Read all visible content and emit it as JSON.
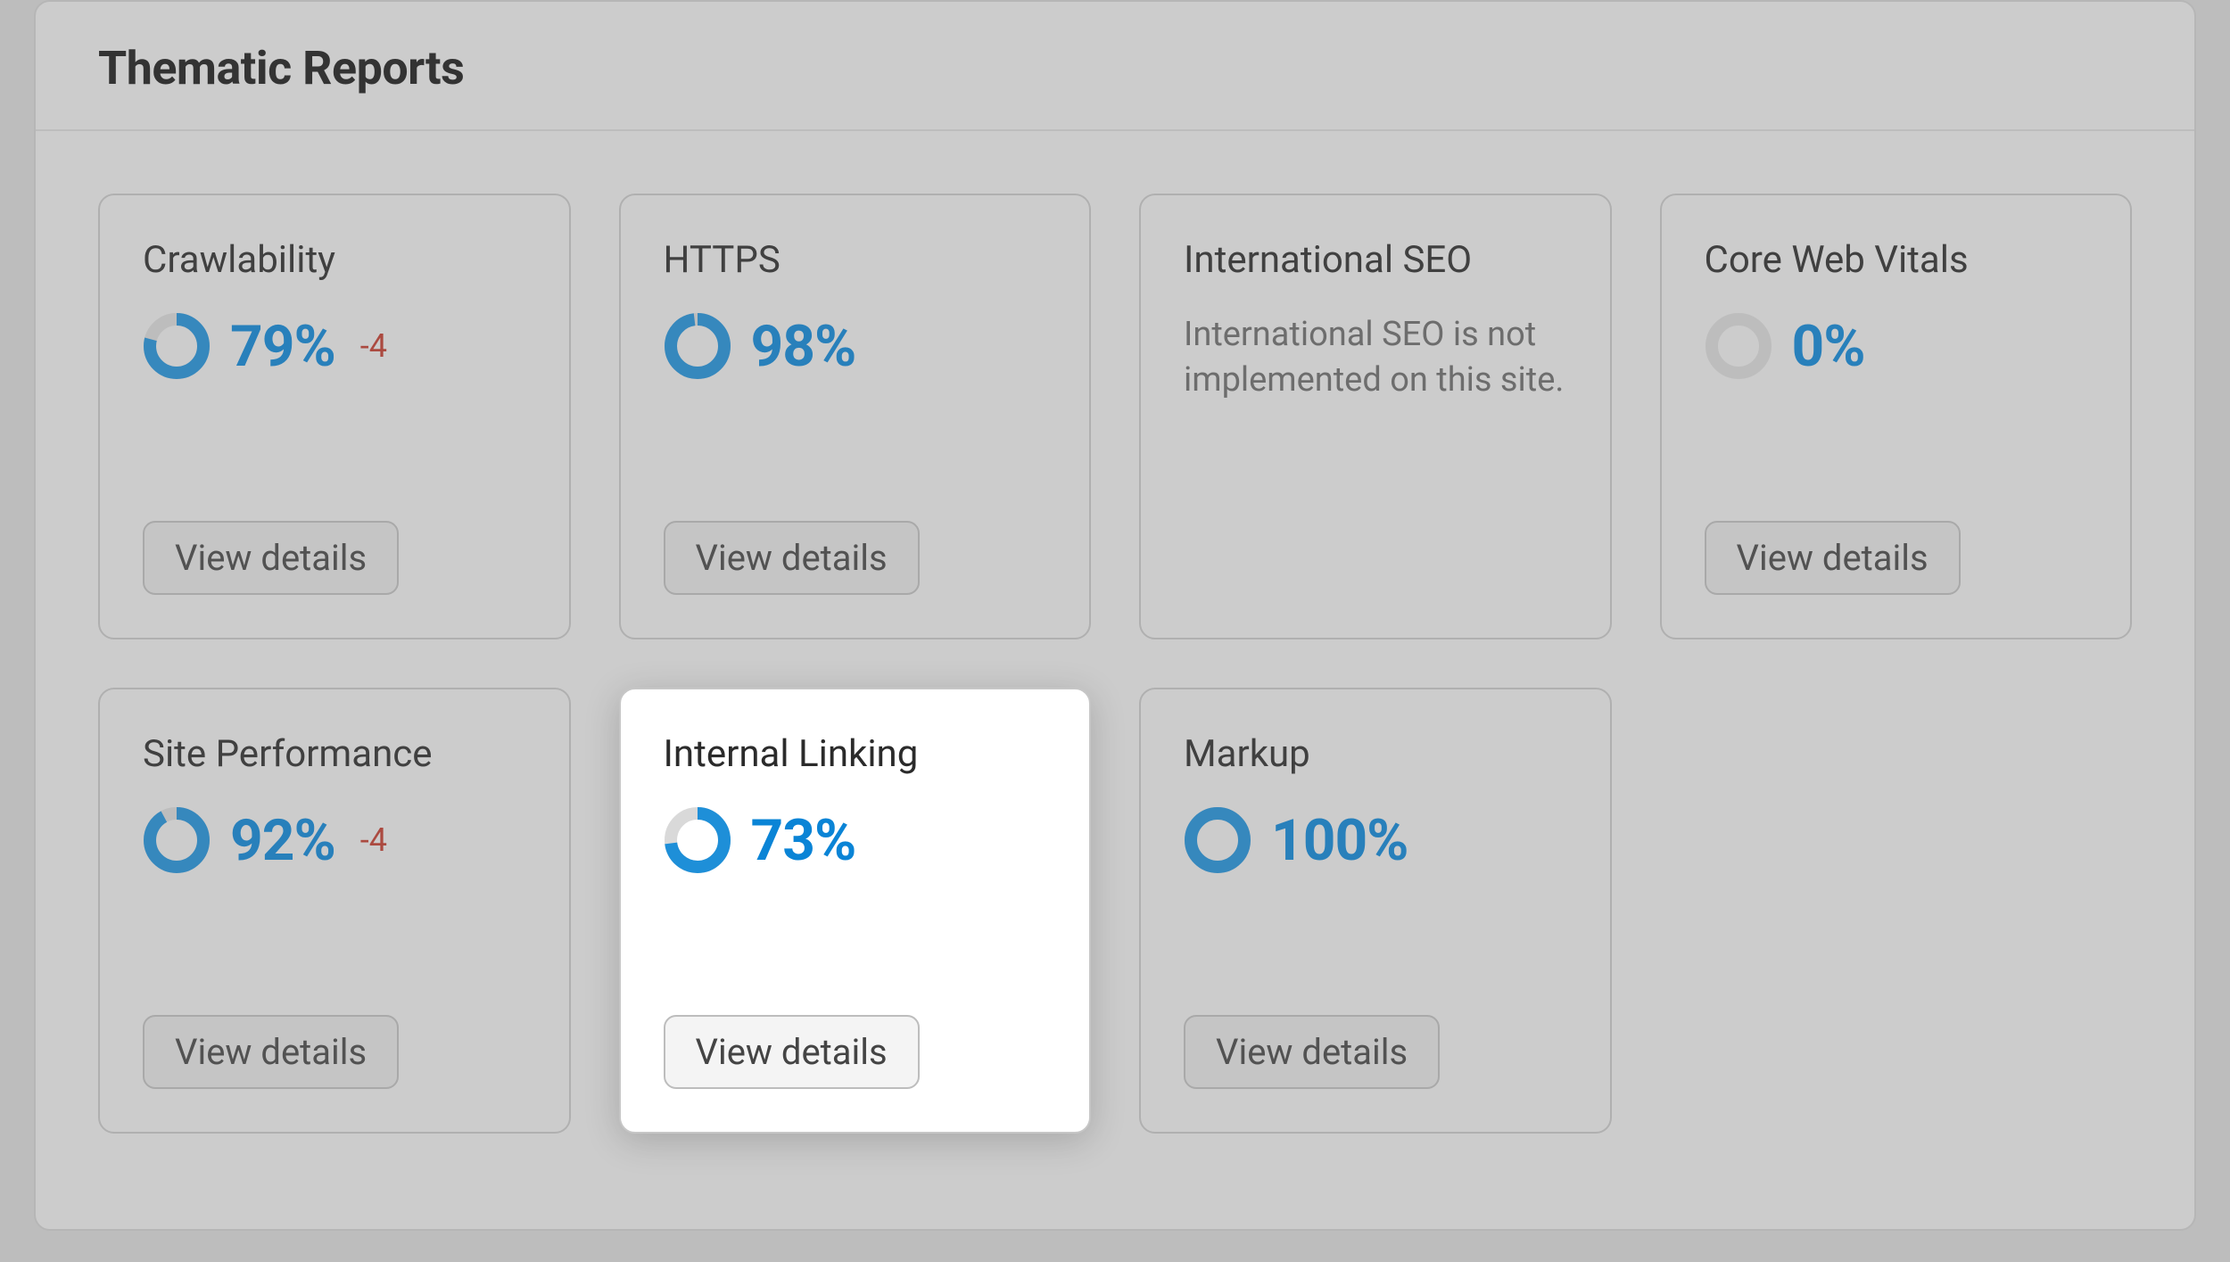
{
  "panel": {
    "title": "Thematic Reports"
  },
  "buttons": {
    "view_details": "View details"
  },
  "colors": {
    "accent": "#1e8fd8",
    "ring_bg": "#d9d9d9",
    "delta_neg": "#c0392b"
  },
  "cards": [
    {
      "id": "crawlability",
      "title": "Crawlability",
      "percent": 79,
      "percent_label": "79%",
      "delta": "-4",
      "has_metric": true,
      "message": null,
      "highlight": false
    },
    {
      "id": "https",
      "title": "HTTPS",
      "percent": 98,
      "percent_label": "98%",
      "delta": null,
      "has_metric": true,
      "message": null,
      "highlight": false
    },
    {
      "id": "international-seo",
      "title": "International SEO",
      "percent": null,
      "percent_label": null,
      "delta": null,
      "has_metric": false,
      "message": "International SEO is not implemented on this site.",
      "highlight": false
    },
    {
      "id": "core-web-vitals",
      "title": "Core Web Vitals",
      "percent": 0,
      "percent_label": "0%",
      "delta": null,
      "has_metric": true,
      "message": null,
      "highlight": false
    },
    {
      "id": "site-performance",
      "title": "Site Performance",
      "percent": 92,
      "percent_label": "92%",
      "delta": "-4",
      "has_metric": true,
      "message": null,
      "highlight": false
    },
    {
      "id": "internal-linking",
      "title": "Internal Linking",
      "percent": 73,
      "percent_label": "73%",
      "delta": null,
      "has_metric": true,
      "message": null,
      "highlight": true
    },
    {
      "id": "markup",
      "title": "Markup",
      "percent": 100,
      "percent_label": "100%",
      "delta": null,
      "has_metric": true,
      "message": null,
      "highlight": false
    }
  ]
}
